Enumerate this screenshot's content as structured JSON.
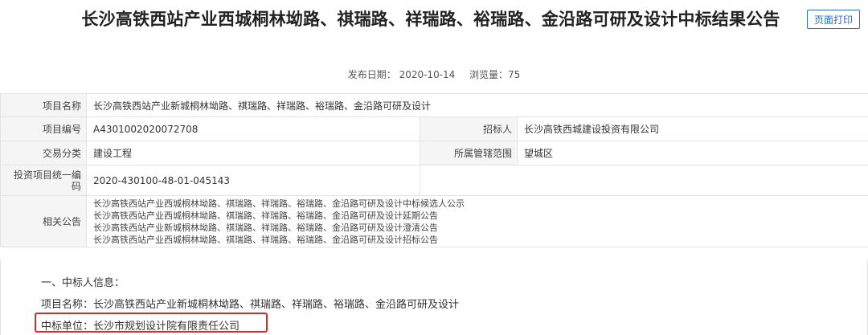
{
  "header": {
    "title": "长沙高铁西站产业西城桐林坳路、祺瑞路、祥瑞路、裕瑞路、金沿路可研及设计中标结果公告",
    "print_label": "页面打印",
    "publish_label": "发布日期：",
    "publish_date": "2020-10-14",
    "views_label": "浏览量：",
    "views": "75"
  },
  "info": {
    "project_name_label": "项目名称",
    "project_name": "长沙高铁西站产业新城桐林坳路、祺瑞路、祥瑞路、裕瑞路、金沿路可研及设计",
    "project_no_label": "项目编号",
    "project_no": "A4301002020072708",
    "tenderer_label": "招标人",
    "tenderer": "长沙高铁西城建设投资有限公司",
    "category_label": "交易分类",
    "category": "建设工程",
    "scope_label": "所属管辖范围",
    "scope": "望城区",
    "unified_code_label": "投资项目统一编码",
    "unified_code": "2020-430100-48-01-045143",
    "related_label": "相关公告",
    "related": [
      "长沙高铁西站产业西城桐林坳路、祺瑞路、祥瑞路、裕瑞路、金沿路可研及设计中标候选人公示",
      "长沙高铁西站产业西城桐林坳路、祺瑞路、祥瑞路、裕瑞路、金沿路可研及设计延期公告",
      "长沙高铁西站产业新城桐林坳路、祺瑞路、祥瑞路、裕瑞路、金沿路可研及设计澄清公告",
      "长沙高铁西站产业西城桐林坳路、祺瑞路、祥瑞路、裕瑞路、金沿路可研及设计招标公告"
    ]
  },
  "content": {
    "section_title": "一、中标人信息：",
    "project_line": "项目名称：长沙高铁西站产业新城桐林坳路、祺瑞路、祥瑞路、裕瑞路、金沿路可研及设计",
    "winner_line": "中标单位：长沙市规划设计院有限责任公司"
  },
  "colors": {
    "accent": "#2b6cc4",
    "highlight_border": "#e02a2a",
    "label_bg": "#f5f5f5"
  }
}
